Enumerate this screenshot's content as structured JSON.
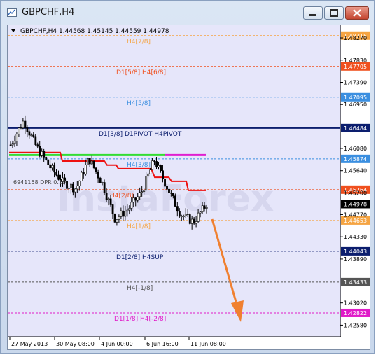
{
  "window": {
    "title": "GBPCHF,H4"
  },
  "chart_header": {
    "symbol_line": "GBPCHF,H4  1.44568 1.45145 1.44559 1.44978"
  },
  "watermark": "InstaForex",
  "price_axis": {
    "ticks": [
      "1.48270",
      "1.47830",
      "1.47390",
      "1.46950",
      "1.46080",
      "1.45640",
      "1.45200",
      "1.44770",
      "1.44330",
      "1.43890",
      "1.43020",
      "1.42580"
    ]
  },
  "time_axis": {
    "labels": [
      "27 May 2013",
      "30 May 08:00",
      "4 Jun 00:00",
      "6 Jun 16:00",
      "11 Jun 08:00"
    ]
  },
  "levels": [
    {
      "label": "H4[7/8]",
      "value": "1.48315",
      "color": "#f5a442"
    },
    {
      "label": "D1[5/8] H4[6/8]",
      "value": "1.47705",
      "color": "#f0501e"
    },
    {
      "label": "H4[5/8]",
      "value": "1.47095",
      "color": "#3b8fe0"
    },
    {
      "label": "D1[3/8] D1PIVOT H4PIVOT",
      "value": "1.46484",
      "color": "#0c1e6e"
    },
    {
      "label": "H4[3/8]",
      "value": "1.45874",
      "color": "#3b8fe0"
    },
    {
      "label": "H4[2/8]",
      "value": "1.45264",
      "color": "#f0501e"
    },
    {
      "label": "H4[1/8]",
      "value": "1.44653",
      "color": "#f5a442"
    },
    {
      "label": "D1[2/8] H4SUP",
      "value": "1.44043",
      "color": "#0c1e6e"
    },
    {
      "label": "H4[-1/8]",
      "value": "1.43433",
      "color": "#555555"
    },
    {
      "label": "D1[1/8] H4[-2/8]",
      "value": "1.42822",
      "color": "#e01ac8"
    }
  ],
  "current_price": {
    "value": "1.44978",
    "color": "#000000"
  },
  "indicator_text": "6941158 DPR 0.10",
  "chart_data": {
    "type": "line",
    "title": "GBPCHF,H4",
    "x": [
      "27 May 2013",
      "30 May 08:00",
      "4 Jun 00:00",
      "6 Jun 16:00",
      "11 Jun 08:00"
    ],
    "series": [
      {
        "values": [
          1.4615,
          1.4663,
          1.461,
          1.4572,
          1.4541,
          1.4528,
          1.4588,
          1.454,
          1.4468,
          1.4488,
          1.452,
          1.4585,
          1.453,
          1.4478,
          1.4462,
          1.4498
        ]
      }
    ],
    "ylim": [
      1.4235,
      1.4852
    ]
  }
}
